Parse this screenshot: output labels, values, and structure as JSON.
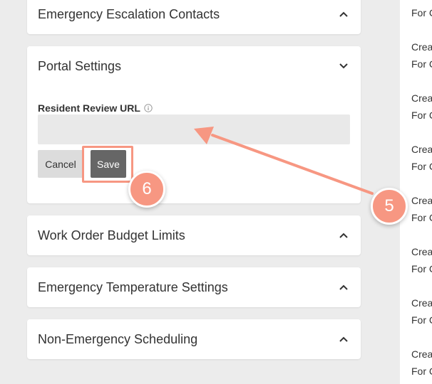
{
  "cards": {
    "escalation": {
      "title": "Emergency Escalation Contacts"
    },
    "portal": {
      "title": "Portal Settings",
      "field_label": "Resident Review URL",
      "field_value": "",
      "field_placeholder": "",
      "cancel_label": "Cancel",
      "save_label": "Save"
    },
    "budget": {
      "title": "Work Order Budget Limits"
    },
    "temperature": {
      "title": "Emergency Temperature Settings"
    },
    "scheduling": {
      "title": "Non-Emergency Scheduling"
    }
  },
  "right_panel": {
    "first_line": "For C",
    "items": [
      {
        "line1": "Crea",
        "line2": "For C"
      },
      {
        "line1": "Crea",
        "line2": "For C"
      },
      {
        "line1": "Crea",
        "line2": "For C"
      },
      {
        "line1": "Crea",
        "line2": "For C"
      },
      {
        "line1": "Crea",
        "line2": "For C"
      },
      {
        "line1": "Crea",
        "line2": "For C"
      },
      {
        "line1": "Crea",
        "line2": "For C"
      }
    ]
  },
  "annotations": {
    "step_5": "5",
    "step_6": "6",
    "accent_color": "#f79782"
  },
  "icons": {
    "collapse": "chevron-up-icon",
    "expand": "chevron-down-icon",
    "info": "info-icon"
  }
}
